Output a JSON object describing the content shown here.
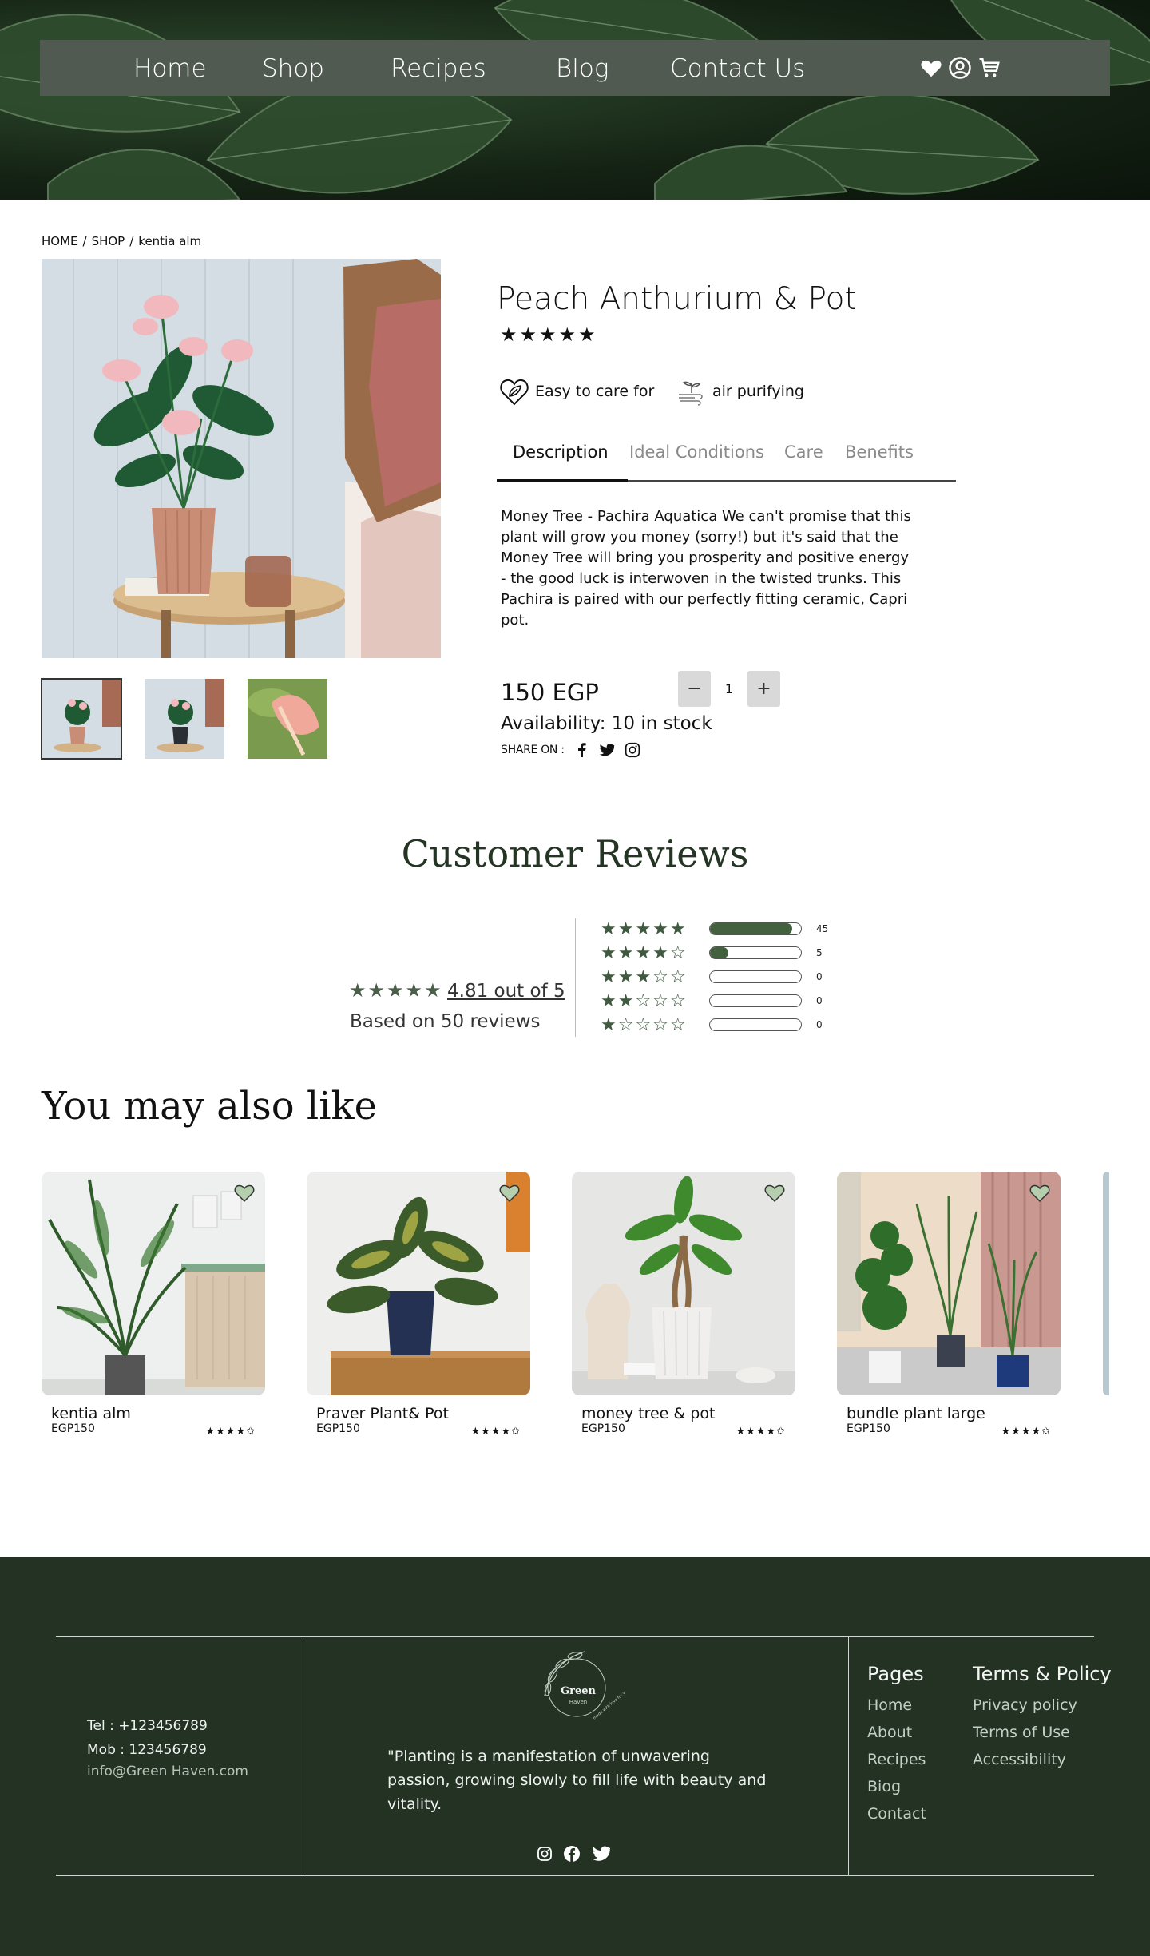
{
  "nav": {
    "items": [
      "Home",
      "Shop",
      "Recipes",
      "Blog",
      "Contact Us"
    ],
    "icons": [
      "heart-icon",
      "user-icon",
      "cart-icon"
    ]
  },
  "breadcrumb": [
    "HOME",
    "/",
    "SHOP",
    "/",
    "kentia alm"
  ],
  "product": {
    "title": "Peach Anthurium & Pot",
    "stars": "★★★★★",
    "features": [
      "Easy to care for",
      "air purifying"
    ],
    "tabs": [
      "Description",
      "Ideal Conditions",
      "Care",
      "Benefits"
    ],
    "active_tab": "Description",
    "description": "Money Tree - Pachira Aquatica We can't promise that this plant will grow you money (sorry!) but it's said that the Money Tree will bring you prosperity and positive energy - the good luck is interwoven in the twisted trunks. This Pachira is paired with our perfectly fitting ceramic, Capri pot.",
    "price": "150 EGP",
    "quantity": "1",
    "qty_minus": "−",
    "qty_plus": "+",
    "availability": "Availability: 10 in stock",
    "share_label": "SHARE ON :",
    "share_icons": [
      "facebook-icon",
      "twitter-icon",
      "instagram-icon"
    ]
  },
  "reviews": {
    "title": "Customer Reviews",
    "summary_stars": "★★★★★",
    "average": "4.81 out of 5",
    "based_on": "Based on 50 reviews",
    "rows": [
      {
        "stars": "★★★★★",
        "count": "45",
        "fraction": 0.9
      },
      {
        "stars": "★★★★☆",
        "count": "5",
        "fraction": 0.2
      },
      {
        "stars": "★★★☆☆",
        "count": "0",
        "fraction": 0
      },
      {
        "stars": "★★☆☆☆",
        "count": "0",
        "fraction": 0
      },
      {
        "stars": "★☆☆☆☆",
        "count": "0",
        "fraction": 0
      }
    ]
  },
  "also_like": {
    "title": "You may also like",
    "cards": [
      {
        "name": "kentia alm",
        "price": "EGP150",
        "stars": "★★★★✩"
      },
      {
        "name": "Praver Plant& Pot",
        "price": "EGP150",
        "stars": "★★★★✩"
      },
      {
        "name": "money tree & pot",
        "price": "EGP150",
        "stars": "★★★★✩"
      },
      {
        "name": "bundle plant large",
        "price": "EGP150",
        "stars": "★★★★✩"
      }
    ]
  },
  "footer": {
    "tel": "Tel : +123456789",
    "mob": "Mob : 123456789",
    "email": "info@Green Haven.com",
    "logo_text": "Green Haven made with love for you",
    "quote": "\"Planting is a manifestation of unwavering passion, growing slowly to fill life with beauty and vitality.",
    "social_icons": [
      "instagram-icon",
      "facebook-icon",
      "twitter-icon"
    ],
    "pages_title": "Pages",
    "pages": [
      "Home",
      "About",
      "Recipes",
      "Biog",
      "Contact"
    ],
    "terms_title": "Terms & Policy",
    "terms": [
      "Privacy policy",
      "Terms of Use",
      "Accessibility"
    ]
  },
  "colors": {
    "nav_bg": "#505a50",
    "accent_green": "#43603f",
    "footer_bg": "#243224",
    "heading_green": "#243524"
  }
}
